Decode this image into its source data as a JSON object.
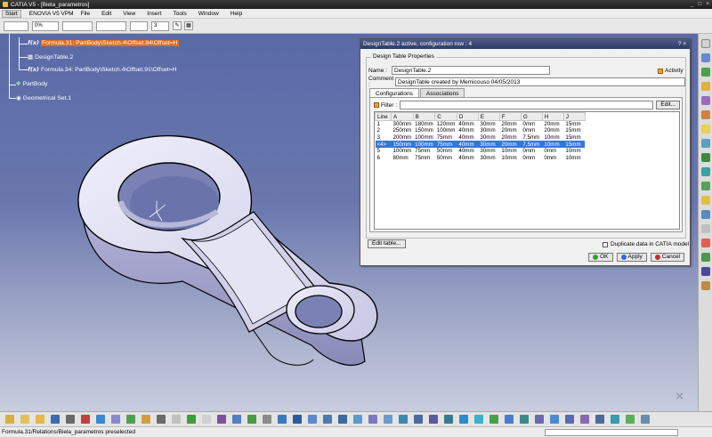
{
  "window": {
    "title": "CATIA V5 - [Biela_parametros]",
    "controls": [
      "_",
      "□",
      "×"
    ]
  },
  "menu": {
    "start": "Start",
    "items": [
      "ENOVIA V5 VPM",
      "File",
      "Edit",
      "View",
      "Insert",
      "Tools",
      "Window",
      "Help"
    ]
  },
  "toolbar": {
    "pct": "0%",
    "num": "3"
  },
  "tree": [
    {
      "icon": "f(x)",
      "label": "Formula.31: PartBody\\Sketch.4\\Offset.84\\Offset=H",
      "selected": true
    },
    {
      "icon": "▦",
      "label": "DesignTable.2",
      "selected": false
    },
    {
      "icon": "f(x)",
      "label": "Formula.34: PartBody\\Sketch.4\\Offset.91\\Offset=H",
      "selected": false
    },
    {
      "icon": "✥",
      "label": "PartBody",
      "selected": false
    },
    {
      "icon": "◉",
      "label": "Geometrical Set.1",
      "selected": false
    }
  ],
  "dialog": {
    "title": "DesignTable.2 active, configuration row : 4",
    "group_label": "Design Table Properties",
    "name_label": "Name :",
    "name_value": "DesignTable.2",
    "activity_label": "Activity",
    "comment_label": "Comment :",
    "comment_value": "DesignTable created by Memicouso 04/05/2013",
    "tabs": [
      "Configurations",
      "Associations"
    ],
    "filter_label": "Filter :",
    "edit_btn": "Edit...",
    "table_headers": [
      "Line",
      "A",
      "B",
      "C",
      "D",
      "E",
      "F",
      "G",
      "H",
      "J"
    ],
    "rows": [
      [
        "1",
        "300mm",
        "180mm",
        "120mm",
        "40mm",
        "30mm",
        "20mm",
        "0mm",
        "20mm",
        "15mm"
      ],
      [
        "2",
        "250mm",
        "150mm",
        "100mm",
        "40mm",
        "30mm",
        "20mm",
        "0mm",
        "20mm",
        "15mm"
      ],
      [
        "3",
        "200mm",
        "100mm",
        "75mm",
        "40mm",
        "30mm",
        "20mm",
        "7,5mm",
        "10mm",
        "15mm"
      ],
      [
        "<4>",
        "150mm",
        "100mm",
        "75mm",
        "40mm",
        "30mm",
        "20mm",
        "7,5mm",
        "10mm",
        "15mm"
      ],
      [
        "5",
        "100mm",
        "75mm",
        "50mm",
        "40mm",
        "30mm",
        "10mm",
        "0mm",
        "0mm",
        "10mm"
      ],
      [
        "6",
        "80mm",
        "75mm",
        "50mm",
        "40mm",
        "30mm",
        "10mm",
        "0mm",
        "0mm",
        "10mm"
      ]
    ],
    "selected_row": 3,
    "edit_table_btn": "Edit table...",
    "duplicate_label": "Duplicate data in CATIA model",
    "ok": "OK",
    "apply": "Apply",
    "cancel": "Cancel"
  },
  "status": {
    "text": "Formula.31/Relations/Biela_parametros preselected"
  },
  "colors": {
    "selection": "#e46c10",
    "table_selection": "#3875d7",
    "part_fill": "#d8d8f0"
  }
}
